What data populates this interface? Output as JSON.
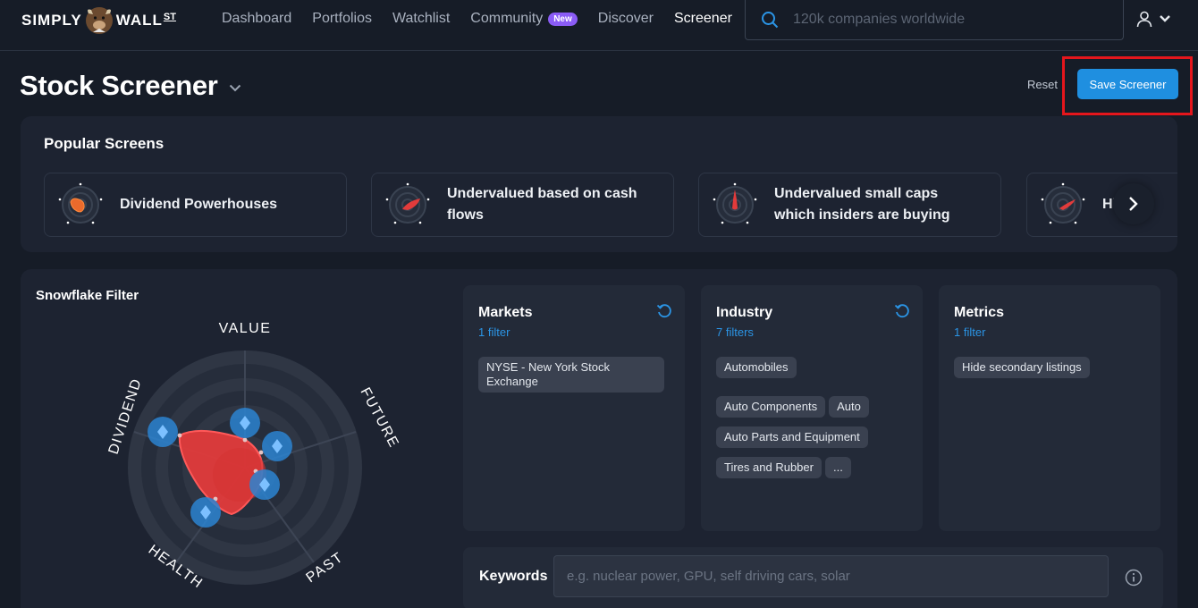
{
  "brand": {
    "logo_text_left": "SIMPLY",
    "logo_text_right": "WALL",
    "logo_suffix": "ST"
  },
  "nav": {
    "items": [
      {
        "label": "Dashboard",
        "active": false
      },
      {
        "label": "Portfolios",
        "active": false
      },
      {
        "label": "Watchlist",
        "active": false
      },
      {
        "label": "Community",
        "active": false,
        "badge": "New"
      },
      {
        "label": "Discover",
        "active": false
      },
      {
        "label": "Screener",
        "active": true
      }
    ],
    "search_placeholder": "120k companies worldwide",
    "user_icon": "user-icon"
  },
  "header": {
    "title": "Stock Screener",
    "reset_label": "Reset",
    "save_label": "Save Screener"
  },
  "popular": {
    "title": "Popular Screens",
    "cards": [
      {
        "label": "Dividend Powerhouses"
      },
      {
        "label": "Undervalued based on cash flows"
      },
      {
        "label": "Undervalued small caps which insiders are buying"
      },
      {
        "label": "Hi"
      }
    ]
  },
  "snowflake": {
    "title": "Snowflake Filter",
    "axes": [
      "VALUE",
      "FUTURE",
      "PAST",
      "HEALTH",
      "DIVIDEND"
    ]
  },
  "filters": {
    "markets": {
      "title": "Markets",
      "count": "1 filter",
      "chips": [
        "NYSE - New York Stock Exchange"
      ]
    },
    "industry": {
      "title": "Industry",
      "count": "7 filters",
      "chips": [
        "Automobiles",
        "Auto Components",
        "Auto",
        "Auto Parts and Equipment",
        "Tires and Rubber",
        "..."
      ]
    },
    "metrics": {
      "title": "Metrics",
      "count": "1 filter",
      "chips": [
        "Hide secondary listings"
      ]
    }
  },
  "keywords": {
    "label": "Keywords",
    "placeholder": "e.g. nuclear power, GPU, self driving cars, solar"
  },
  "colors": {
    "accent": "#1f8fe0",
    "snowflake_red": "#e23b3b",
    "badge_purple": "#8b5cf6",
    "highlight": "#e5161c"
  }
}
